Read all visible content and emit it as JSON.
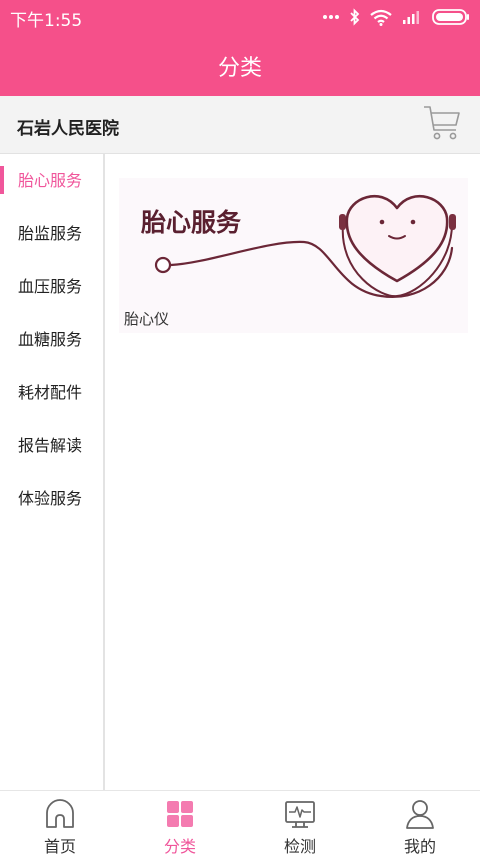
{
  "status_bar": {
    "time": "下午1:55",
    "icons": [
      "more-dots-icon",
      "bluetooth-icon",
      "wifi-icon",
      "signal-icon",
      "battery-icon"
    ]
  },
  "header": {
    "title": "分类"
  },
  "hospital": {
    "name": "石岩人民医院",
    "cart_icon": "cart-icon"
  },
  "sidebar": {
    "active_index": 0,
    "items": [
      {
        "label": "胎心服务"
      },
      {
        "label": "胎监服务"
      },
      {
        "label": "血压服务"
      },
      {
        "label": "血糖服务"
      },
      {
        "label": "耗材配件"
      },
      {
        "label": "报告解读"
      },
      {
        "label": "体验服务"
      }
    ]
  },
  "main": {
    "products": [
      {
        "banner_text": "胎心服务",
        "label": "胎心仪"
      }
    ]
  },
  "bottom_nav": {
    "items": [
      {
        "label": "首页",
        "icon": "home-icon"
      },
      {
        "label": "分类",
        "icon": "category-grid-icon"
      },
      {
        "label": "检测",
        "icon": "monitor-icon"
      },
      {
        "label": "我的",
        "icon": "user-icon"
      }
    ],
    "active_index": 1
  },
  "colors": {
    "brand_pink": "#f5508a",
    "active_pink": "#f0569b",
    "banner_dark": "#6b2737"
  }
}
